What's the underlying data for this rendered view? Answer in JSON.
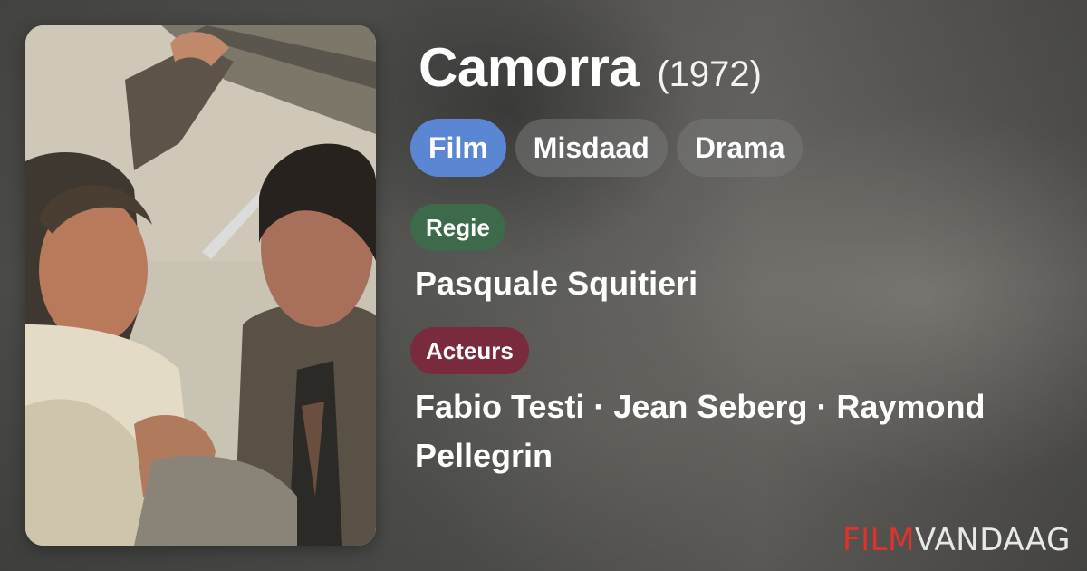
{
  "movie": {
    "title": "Camorra",
    "year": "(1972)"
  },
  "tags": [
    "Film",
    "Misdaad",
    "Drama"
  ],
  "director": {
    "label": "Regie",
    "names": "Pasquale Squitieri"
  },
  "actors": {
    "label": "Acteurs",
    "names": "Fabio Testi · Jean Seberg · Raymond Pellegrin"
  },
  "brand": {
    "part1": "FILM",
    "part2": "VANDAAG"
  },
  "colors": {
    "primary_tag": "#5b86d4",
    "director_label": "#3d6a4b",
    "actors_label": "#7a2a3d",
    "brand_red": "#e0322d"
  }
}
